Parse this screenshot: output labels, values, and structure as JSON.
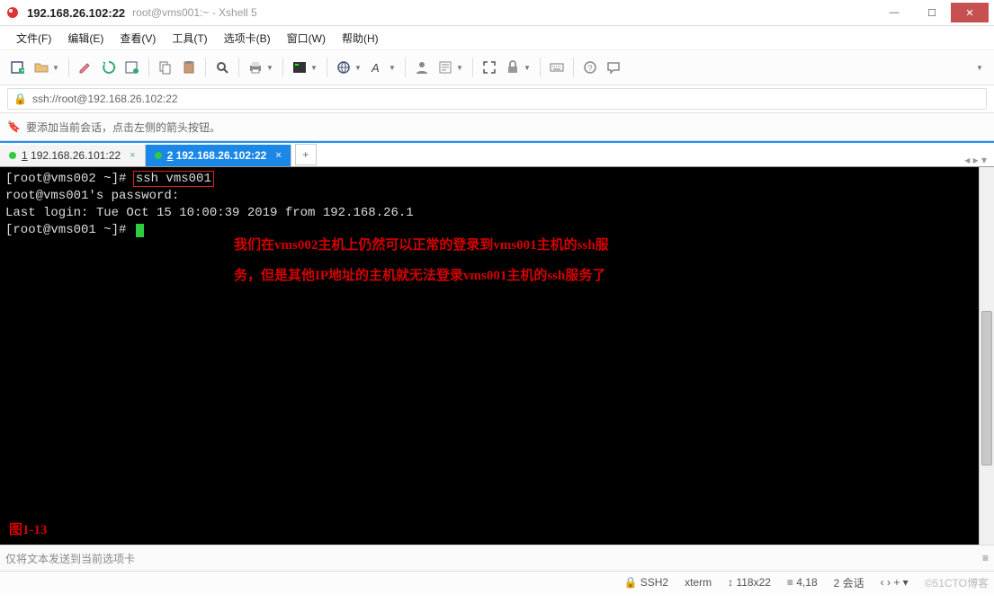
{
  "window": {
    "host": "192.168.26.102:22",
    "path": "root@vms001:~ - Xshell 5"
  },
  "menubar": {
    "file": "文件(F)",
    "edit": "编辑(E)",
    "view": "查看(V)",
    "tools": "工具(T)",
    "tabs": "选项卡(B)",
    "window": "窗口(W)",
    "help": "帮助(H)"
  },
  "address": {
    "url": "ssh://root@192.168.26.102:22"
  },
  "hint": {
    "text": "要添加当前会话，点击左侧的箭头按钮。"
  },
  "tabs": {
    "tab1_label": "1 192.168.26.101:22",
    "tab2_label": "2 192.168.26.102:22",
    "add": "+",
    "nav": "◂ ▸ ▾"
  },
  "terminal": {
    "line1_prompt": "[root@vms002 ~]# ",
    "line1_cmd": "ssh vms001",
    "line2": "root@vms001's password:",
    "line3": "Last login: Tue Oct 15 10:00:39 2019 from 192.168.26.1",
    "line4_prompt": "[root@vms001 ~]# ",
    "annotation_a": "我们在vms002主机上仍然可以正常的登录到vms001主机的ssh服",
    "annotation_b": "务，但是其他IP地址的主机就无法登录vms001主机的ssh服务了",
    "figure_label": "图1-13"
  },
  "sendbar": {
    "placeholder": "仅将文本发送到当前选项卡"
  },
  "status": {
    "proto_icon": "🔒",
    "proto": "SSH2",
    "termtype": "xterm",
    "size_icon": "↕",
    "size": "118x22",
    "pos_icon": "≡",
    "pos": "4,18",
    "sessions": "2 会话",
    "tab_nav": "‹  ›  +  ▾",
    "watermark": "©51CTO博客"
  }
}
